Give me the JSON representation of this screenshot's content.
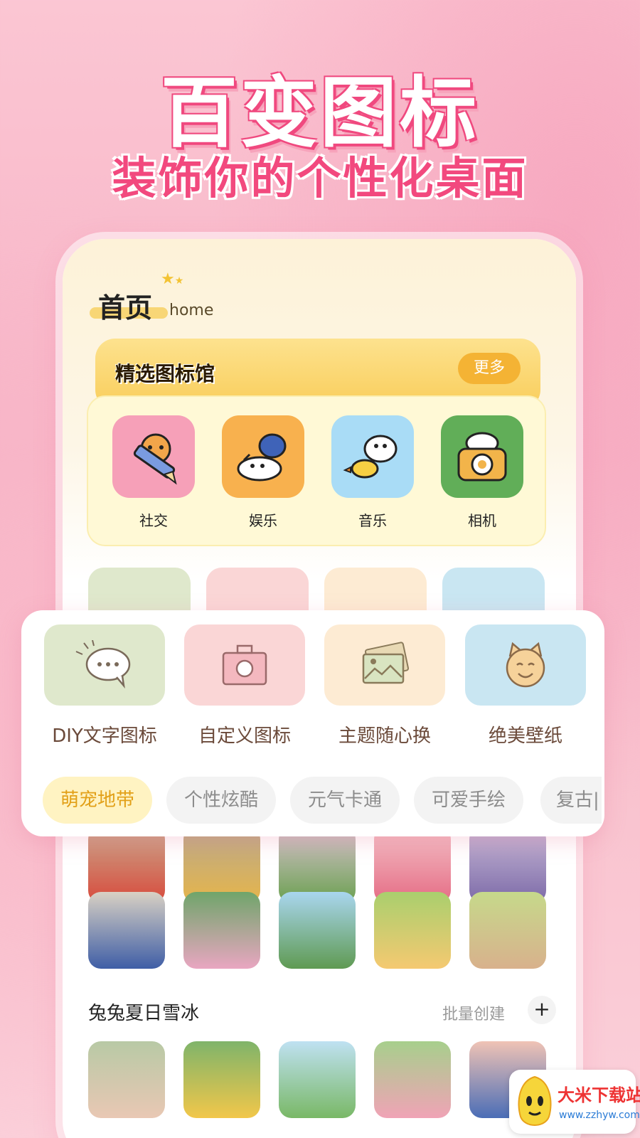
{
  "hero": {
    "title": "百变图标",
    "subtitle": "装饰你的个性化桌面"
  },
  "header": {
    "title": "首页",
    "subtitle": "home"
  },
  "banner": {
    "title": "精选图标馆",
    "more_label": "更多"
  },
  "featured_icons": [
    {
      "label": "社交",
      "icon": "tiger-pencil-icon",
      "bg": "#f6a0b8"
    },
    {
      "label": "娱乐",
      "icon": "cow-dog-icon",
      "bg": "#f8b14e"
    },
    {
      "label": "音乐",
      "icon": "dog-duck-icon",
      "bg": "#a9dcf6"
    },
    {
      "label": "相机",
      "icon": "camera-cat-icon",
      "bg": "#61ae58"
    }
  ],
  "features": [
    {
      "label": "DIY文字图标",
      "icon": "chat-bubble-icon",
      "bg": "#dfe8cc"
    },
    {
      "label": "自定义图标",
      "icon": "camera-icon",
      "bg": "#fad6d6"
    },
    {
      "label": "主题随心换",
      "icon": "picture-icon",
      "bg": "#fdebd3"
    },
    {
      "label": "绝美壁纸",
      "icon": "cat-face-icon",
      "bg": "#c9e6f2"
    }
  ],
  "categories": [
    {
      "label": "萌宠地带",
      "active": true
    },
    {
      "label": "个性炫酷",
      "active": false
    },
    {
      "label": "元气卡通",
      "active": false
    },
    {
      "label": "可爱手绘",
      "active": false
    },
    {
      "label": "复古|",
      "active": false
    }
  ],
  "section": {
    "title": "兔兔夏日雪冰",
    "batch_label": "批量创建",
    "add_icon": "plus-icon"
  },
  "watermark": {
    "name": "大米下载站",
    "url": "www.zzhyw.com"
  },
  "colors": {
    "accent": "#f0497f",
    "yellow": "#f4b334",
    "active_chip_text": "#e2a018"
  }
}
